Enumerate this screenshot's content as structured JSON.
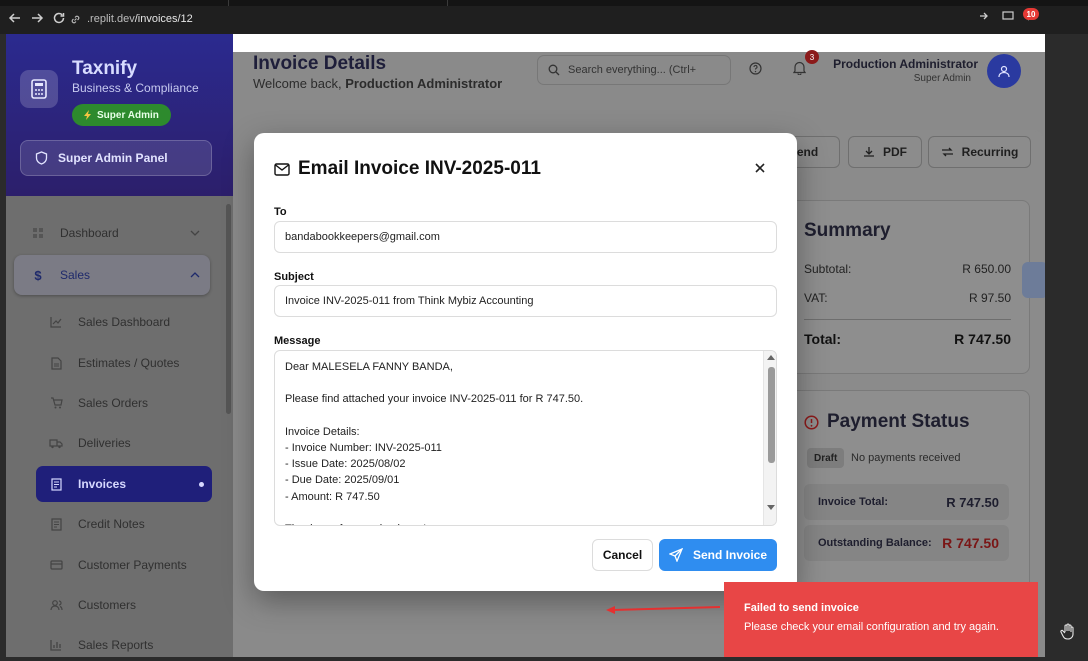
{
  "browser": {
    "url_host": ".replit.dev",
    "url_path": "/invoices/12",
    "extension_badge": "10"
  },
  "sidebar": {
    "brand": "Taxnify",
    "brand_sub": "Business & Compliance",
    "role_pill": "Super Admin",
    "panel_button": "Super Admin Panel",
    "items": [
      {
        "label": "Dashboard",
        "icon": "grid-icon"
      },
      {
        "label": "Sales",
        "icon": "dollar-icon"
      },
      {
        "label": "Sales Dashboard",
        "icon": "chart-line-icon"
      },
      {
        "label": "Estimates / Quotes",
        "icon": "document-icon"
      },
      {
        "label": "Sales Orders",
        "icon": "cart-icon"
      },
      {
        "label": "Deliveries",
        "icon": "truck-icon"
      },
      {
        "label": "Invoices",
        "icon": "receipt-icon"
      },
      {
        "label": "Credit Notes",
        "icon": "document-icon"
      },
      {
        "label": "Customer Payments",
        "icon": "card-icon"
      },
      {
        "label": "Customers",
        "icon": "users-icon"
      },
      {
        "label": "Sales Reports",
        "icon": "bar-chart-icon"
      }
    ]
  },
  "header": {
    "title": "Invoice Details",
    "welcome_prefix": "Welcome back, ",
    "welcome_name": "Production Administrator",
    "search_placeholder": "Search everything... (Ctrl+",
    "notif_count": "3",
    "user_name": "Production Administrator",
    "user_role": "Super Admin"
  },
  "toolbar": {
    "send": "Send",
    "pdf": "PDF",
    "recurring": "Recurring"
  },
  "summary": {
    "title": "Summary",
    "subtotal_label": "Subtotal:",
    "subtotal_value": "R 650.00",
    "vat_label": "VAT:",
    "vat_value": "R 97.50",
    "total_label": "Total:",
    "total_value": "R 747.50"
  },
  "payment": {
    "title": "Payment Status",
    "badge": "Draft",
    "status_text": "No payments received",
    "invoice_total_label": "Invoice Total:",
    "invoice_total_value": "R 747.50",
    "outstanding_label": "Outstanding Balance:",
    "outstanding_value": "R 747.50"
  },
  "modal": {
    "title": "Email Invoice INV-2025-011",
    "to_label": "To",
    "to_value": "bandabookkeepers@gmail.com",
    "subject_label": "Subject",
    "subject_value": "Invoice INV-2025-011 from Think Mybiz Accounting",
    "message_label": "Message",
    "message_lines": [
      "Dear MALESELA FANNY BANDA,",
      "",
      "Please find attached your invoice INV-2025-011 for R 747.50.",
      "",
      "Invoice Details:",
      "- Invoice Number: INV-2025-011",
      "- Issue Date: 2025/08/02",
      "- Due Date: 2025/09/01",
      "- Amount: R 747.50",
      "",
      "Thank you for your business!"
    ],
    "cancel": "Cancel",
    "send": "Send Invoice"
  },
  "toast": {
    "title": "Failed to send invoice",
    "body": "Please check your email configuration and try again."
  },
  "colors": {
    "primary": "#2f8df0",
    "toast_error": "#e84646",
    "sidebar_header": "#2b2a8f",
    "role_pill": "#2d8a2d"
  }
}
